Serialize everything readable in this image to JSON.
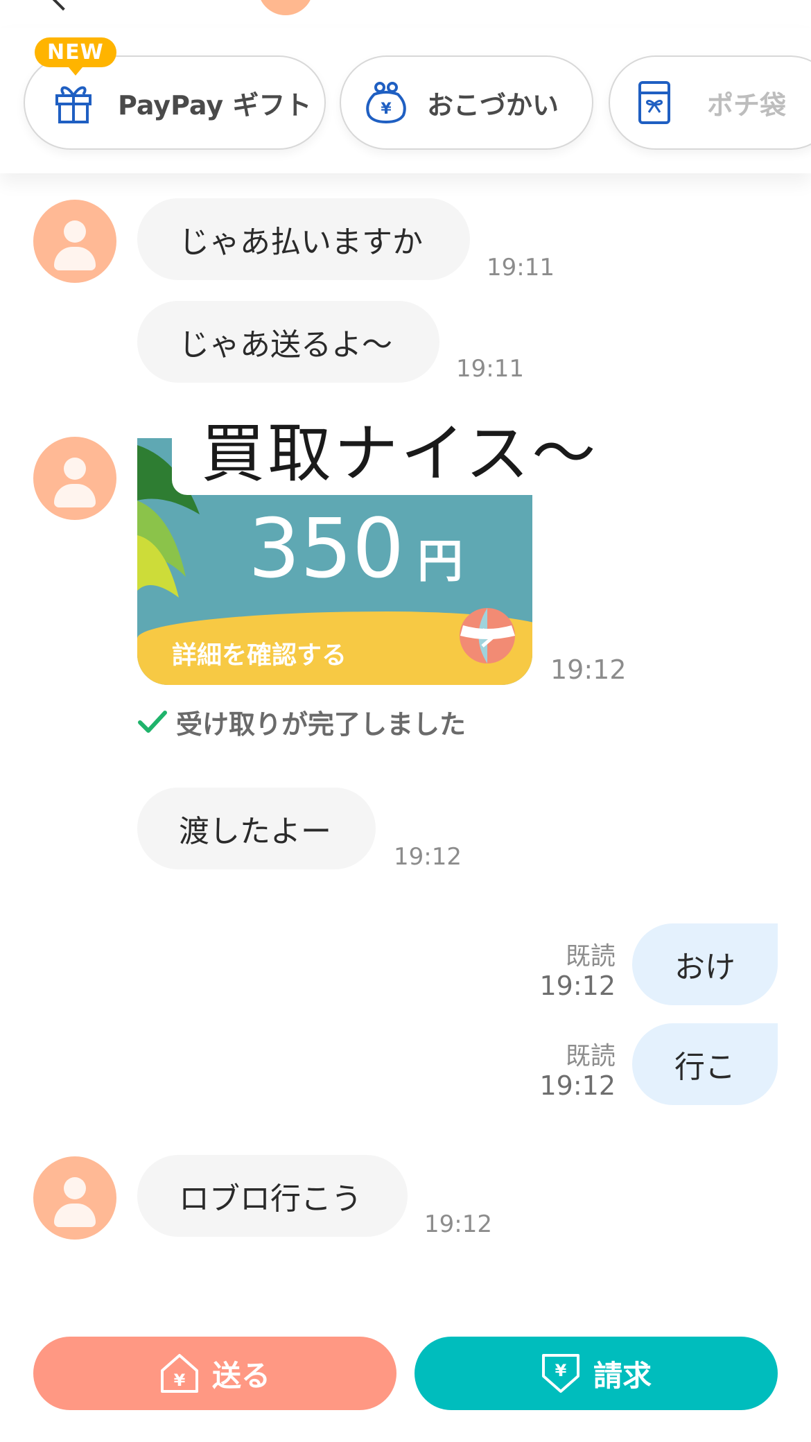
{
  "chips": {
    "new_badge": "NEW",
    "gift": "PayPay ギフト",
    "allowance": "おこづかい",
    "pochi": "ポチ袋"
  },
  "messages": {
    "m1": {
      "text": "じゃあ払いますか",
      "time": "19:11"
    },
    "m2": {
      "text": "じゃあ送るよ〜",
      "time": "19:11"
    },
    "sticker": {
      "text": "買取ナイス〜"
    },
    "payment": {
      "amount": "350",
      "unit": "円",
      "detail": "詳細を確認する",
      "time": "19:12",
      "status": "受け取りが完了しました"
    },
    "m3": {
      "text": "渡したよー",
      "time": "19:12"
    },
    "out1": {
      "text": "おけ",
      "read": "既読",
      "time": "19:12"
    },
    "out2": {
      "text": "行こ",
      "read": "既読",
      "time": "19:12"
    },
    "m4": {
      "text": "ロブロ行こう",
      "time": "19:12"
    }
  },
  "actions": {
    "send": "送る",
    "request": "請求"
  },
  "colors": {
    "send": "#ff9883",
    "request": "#00bdbd",
    "avatar": "#ffb995",
    "outgoing_bubble": "#e4f1fd"
  }
}
